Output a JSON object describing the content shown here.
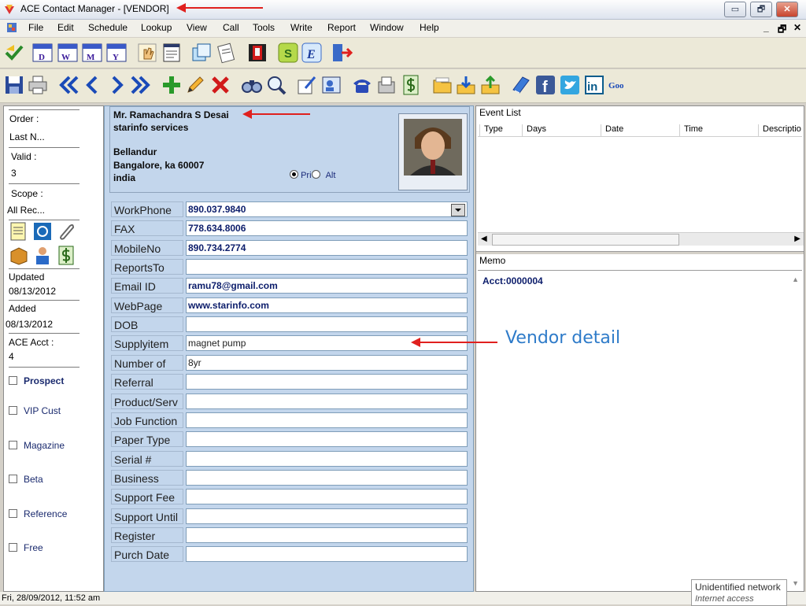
{
  "window": {
    "title": "ACE Contact Manager - [VENDOR]",
    "controls": {
      "minimize": "▭",
      "restore": "🗗",
      "close": "✕"
    }
  },
  "menubar": {
    "items": [
      "File",
      "Edit",
      "Schedule",
      "Lookup",
      "View",
      "Call",
      "Tools",
      "Write",
      "Report",
      "Window",
      "Help"
    ],
    "mdi_controls": [
      "_",
      "🗗",
      "✕"
    ]
  },
  "toolbar1": {
    "icons": [
      "check-arrow-icon",
      "calendar-day-icon",
      "calendar-week-icon",
      "calendar-month-icon",
      "calendar-year-icon",
      "hand-icon",
      "notepad-icon",
      "copy-icon",
      "clipboard-icon",
      "book-icon",
      "dollar-green-icon",
      "euro-icon",
      "exit-door-icon"
    ],
    "calendar_letters": [
      "D",
      "W",
      "M",
      "Y"
    ],
    "currency_letters": [
      "S",
      "E"
    ]
  },
  "toolbar2": {
    "icons": [
      "save-icon",
      "print-icon",
      "first-record-icon",
      "prev-record-icon",
      "next-record-icon",
      "last-record-icon",
      "add-icon",
      "edit-pencil-icon",
      "delete-icon",
      "binoculars-icon",
      "magnifier-icon",
      "note-edit-icon",
      "contact-card-icon",
      "phone-icon",
      "fax-icon",
      "dollar-icon",
      "folder-icon",
      "import-icon",
      "export-icon",
      "book-blue-icon",
      "facebook-icon",
      "twitter-icon",
      "linkedin-icon",
      "google-icon"
    ],
    "social_letters": {
      "facebook": "f",
      "linkedin": "in",
      "google": "Goo"
    }
  },
  "left": {
    "order_label": "Order :",
    "order_value": "Last N...",
    "valid_label": "Valid   :",
    "valid_value": "3",
    "scope_label": "Scope :",
    "scope_value": "All Rec...",
    "updated_label": "Updated",
    "updated_value": "08/13/2012",
    "added_label": "Added",
    "added_value": "08/13/2012",
    "acct_label": "ACE Acct :",
    "acct_value": "4",
    "checkboxes": [
      {
        "label": "Prospect",
        "checked": false,
        "bold": true
      },
      {
        "label": "VIP Cust",
        "checked": false
      },
      {
        "label": "Magazine",
        "checked": false
      },
      {
        "label": "Beta",
        "checked": false
      },
      {
        "label": "Reference",
        "checked": false
      },
      {
        "label": "Free",
        "checked": false
      }
    ]
  },
  "contact": {
    "name": "Mr. Ramachandra S Desai",
    "company": "starinfo services",
    "address1": "Bellandur",
    "address2": "Bangalore, ka 60007",
    "country": "india",
    "radio_primary": "Pri",
    "radio_alt": "Alt",
    "radio_selected": "Pri"
  },
  "fields": [
    {
      "label": "WorkPhone",
      "value": "890.037.9840",
      "style": "bold",
      "dropdown": true
    },
    {
      "label": "FAX",
      "value": "778.634.8006",
      "style": "bold"
    },
    {
      "label": "MobileNo",
      "value": "890.734.2774",
      "style": "bold"
    },
    {
      "label": "ReportsTo",
      "value": ""
    },
    {
      "label": "Email ID",
      "value": "ramu78@gmail.com",
      "style": "bold"
    },
    {
      "label": "WebPage",
      "value": "www.starinfo.com",
      "style": "bold"
    },
    {
      "label": "DOB",
      "value": ""
    },
    {
      "label": "Supplyitem",
      "value": "magnet pump",
      "style": "plain"
    },
    {
      "label": "Number of",
      "value": "8yr",
      "style": "plain"
    },
    {
      "label": "Referral",
      "value": ""
    },
    {
      "label": "Product/Serv",
      "value": ""
    },
    {
      "label": "Job Function",
      "value": ""
    },
    {
      "label": "Paper Type",
      "value": ""
    },
    {
      "label": "Serial #",
      "value": ""
    },
    {
      "label": "Business",
      "value": ""
    },
    {
      "label": "Support Fee",
      "value": ""
    },
    {
      "label": "Support Until",
      "value": ""
    },
    {
      "label": "Register",
      "value": ""
    },
    {
      "label": "Purch Date",
      "value": ""
    }
  ],
  "events": {
    "title": "Event List",
    "columns": [
      "Type",
      "Days",
      "Date",
      "Time",
      "Descriptio"
    ]
  },
  "memo": {
    "title": "Memo",
    "text": "Acct:0000004"
  },
  "status": {
    "datetime": "Fri, 28/09/2012, 11:52 am"
  },
  "tray": {
    "line1": "Unidentified network",
    "line2": "Internet access"
  },
  "annotation": {
    "label": "Vendor detail",
    "color": "#2e7bc9",
    "arrow_color": "#e0201e"
  }
}
